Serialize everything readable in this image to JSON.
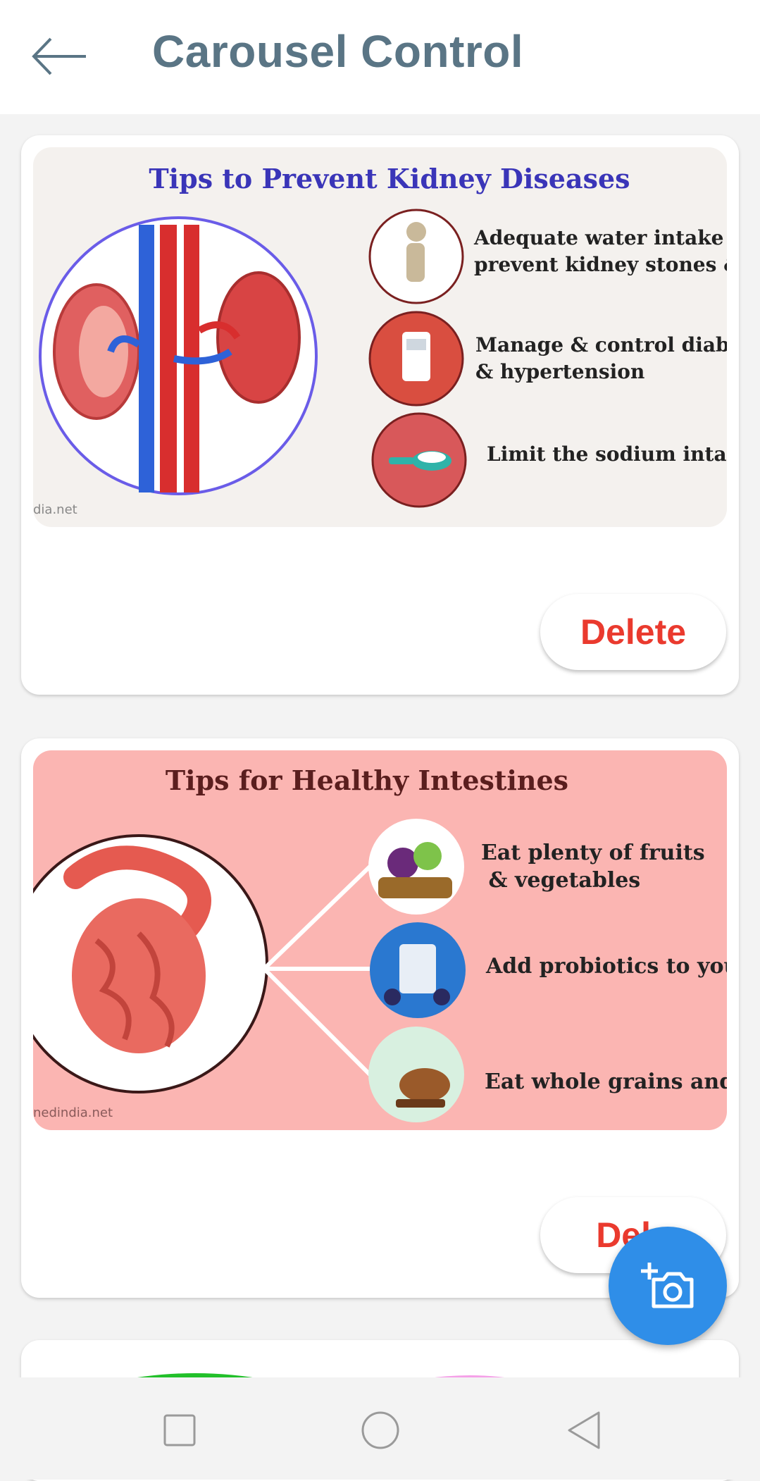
{
  "header": {
    "title": "Carousel Control",
    "back_icon": "arrow-left-icon"
  },
  "cards": [
    {
      "image": {
        "title": "Tips to Prevent Kidney Diseases",
        "tips": [
          "Adequate water intake",
          "prevent kidney stones &",
          "Manage & control diab",
          "& hypertension",
          "Limit the sodium inta"
        ],
        "watermark": "dia.net"
      },
      "delete_label": "Delete"
    },
    {
      "image": {
        "title": "Tips for Healthy Intestines",
        "tips": [
          "Eat plenty of fruits",
          " & vegetables",
          "Add probiotics to you",
          "Eat whole grains and"
        ],
        "watermark": "nedindia.net"
      },
      "delete_label": "Dele"
    }
  ],
  "fab": {
    "icon": "add-photo-camera-icon"
  },
  "navbar": {
    "icons": [
      "square-recents-icon",
      "circle-home-icon",
      "triangle-back-icon"
    ]
  },
  "colors": {
    "title": "#5a7585",
    "delete": "#ea3a2e",
    "fab": "#2f8ee8",
    "kidney_title": "#3a35b8",
    "intestine_title": "#5a1e1e",
    "intestine_bg": "#fbb5b2"
  }
}
